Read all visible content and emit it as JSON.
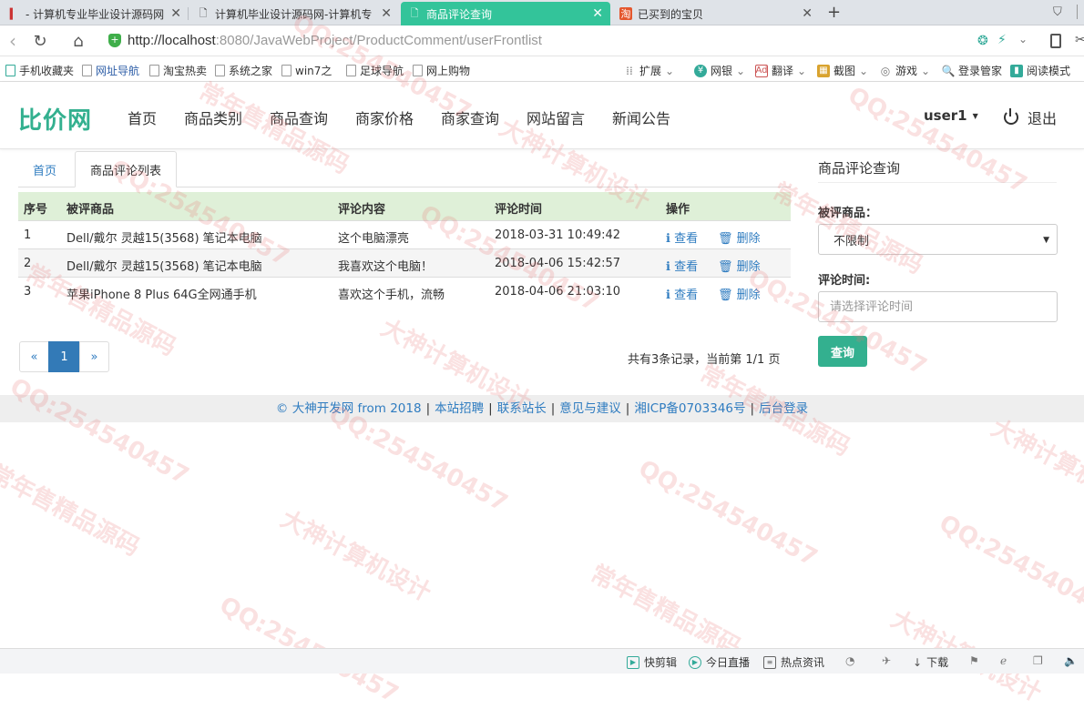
{
  "browser": {
    "tabs": [
      {
        "title": "- 计算机专业毕业设计源码网",
        "active": false
      },
      {
        "title": "计算机毕业设计源码网-计算机专",
        "active": false
      },
      {
        "title": "商品评论查询",
        "active": true
      },
      {
        "title": "已买到的宝贝",
        "active": false
      }
    ],
    "new_tab": "+",
    "url_host": "http://localhost",
    "url_rest": ":8080/JavaWebProject/ProductComment/userFrontlist",
    "bookmarks": [
      "手机收藏夹",
      "网址导航",
      "淘宝热卖",
      "系统之家",
      "win7之",
      "足球导航",
      "网上购物"
    ],
    "toolbar_items": [
      "扩展",
      "网银",
      "翻译",
      "截图",
      "游戏",
      "登录管家",
      "阅读模式"
    ]
  },
  "site": {
    "brand": "比价网",
    "nav": [
      "首页",
      "商品类别",
      "商品查询",
      "商家价格",
      "商家查询",
      "网站留言",
      "新闻公告"
    ],
    "user": "user1",
    "logout": "退出"
  },
  "breadcrumb": {
    "home": "首页",
    "current": "商品评论列表"
  },
  "table": {
    "columns": [
      "序号",
      "被评商品",
      "评论内容",
      "评论时间",
      "操作"
    ],
    "rows": [
      {
        "no": "1",
        "product": "Dell/戴尔 灵越15(3568) 笔记本电脑",
        "content": "这个电脑漂亮",
        "time": "2018-03-31 10:49:42"
      },
      {
        "no": "2",
        "product": "Dell/戴尔 灵越15(3568) 笔记本电脑",
        "content": "我喜欢这个电脑！",
        "time": "2018-04-06 15:42:57"
      },
      {
        "no": "3",
        "product": "苹果iPhone 8 Plus 64G全网通手机",
        "content": "喜欢这个手机，流畅",
        "time": "2018-04-06 21:03:10"
      }
    ],
    "action_view": "查看",
    "action_delete": "删除"
  },
  "pagination": {
    "prev": "«",
    "current": "1",
    "next": "»",
    "summary": "共有3条记录，当前第 1/1 页"
  },
  "search_panel": {
    "title": "商品评论查询",
    "product_label": "被评商品：",
    "product_value": "不限制",
    "time_label": "评论时间:",
    "time_placeholder": "请选择评论时间",
    "submit": "查询"
  },
  "footer": {
    "copyright": "© 大神开发网 from 2018",
    "links": [
      "本站招聘",
      "联系站长",
      "意见与建议",
      "湘ICP备0703346号",
      "后台登录"
    ]
  },
  "watermarks": [
    "QQ:254540457",
    "大神计算机设计",
    "常年售精品源码"
  ],
  "statusbar": [
    "快剪辑",
    "今日直播",
    "热点资讯",
    "下载"
  ],
  "colors": {
    "brand": "#33b08f",
    "link": "#2f7cc0",
    "table_head": "#dff0d8",
    "active_tab": "#33c49a"
  }
}
